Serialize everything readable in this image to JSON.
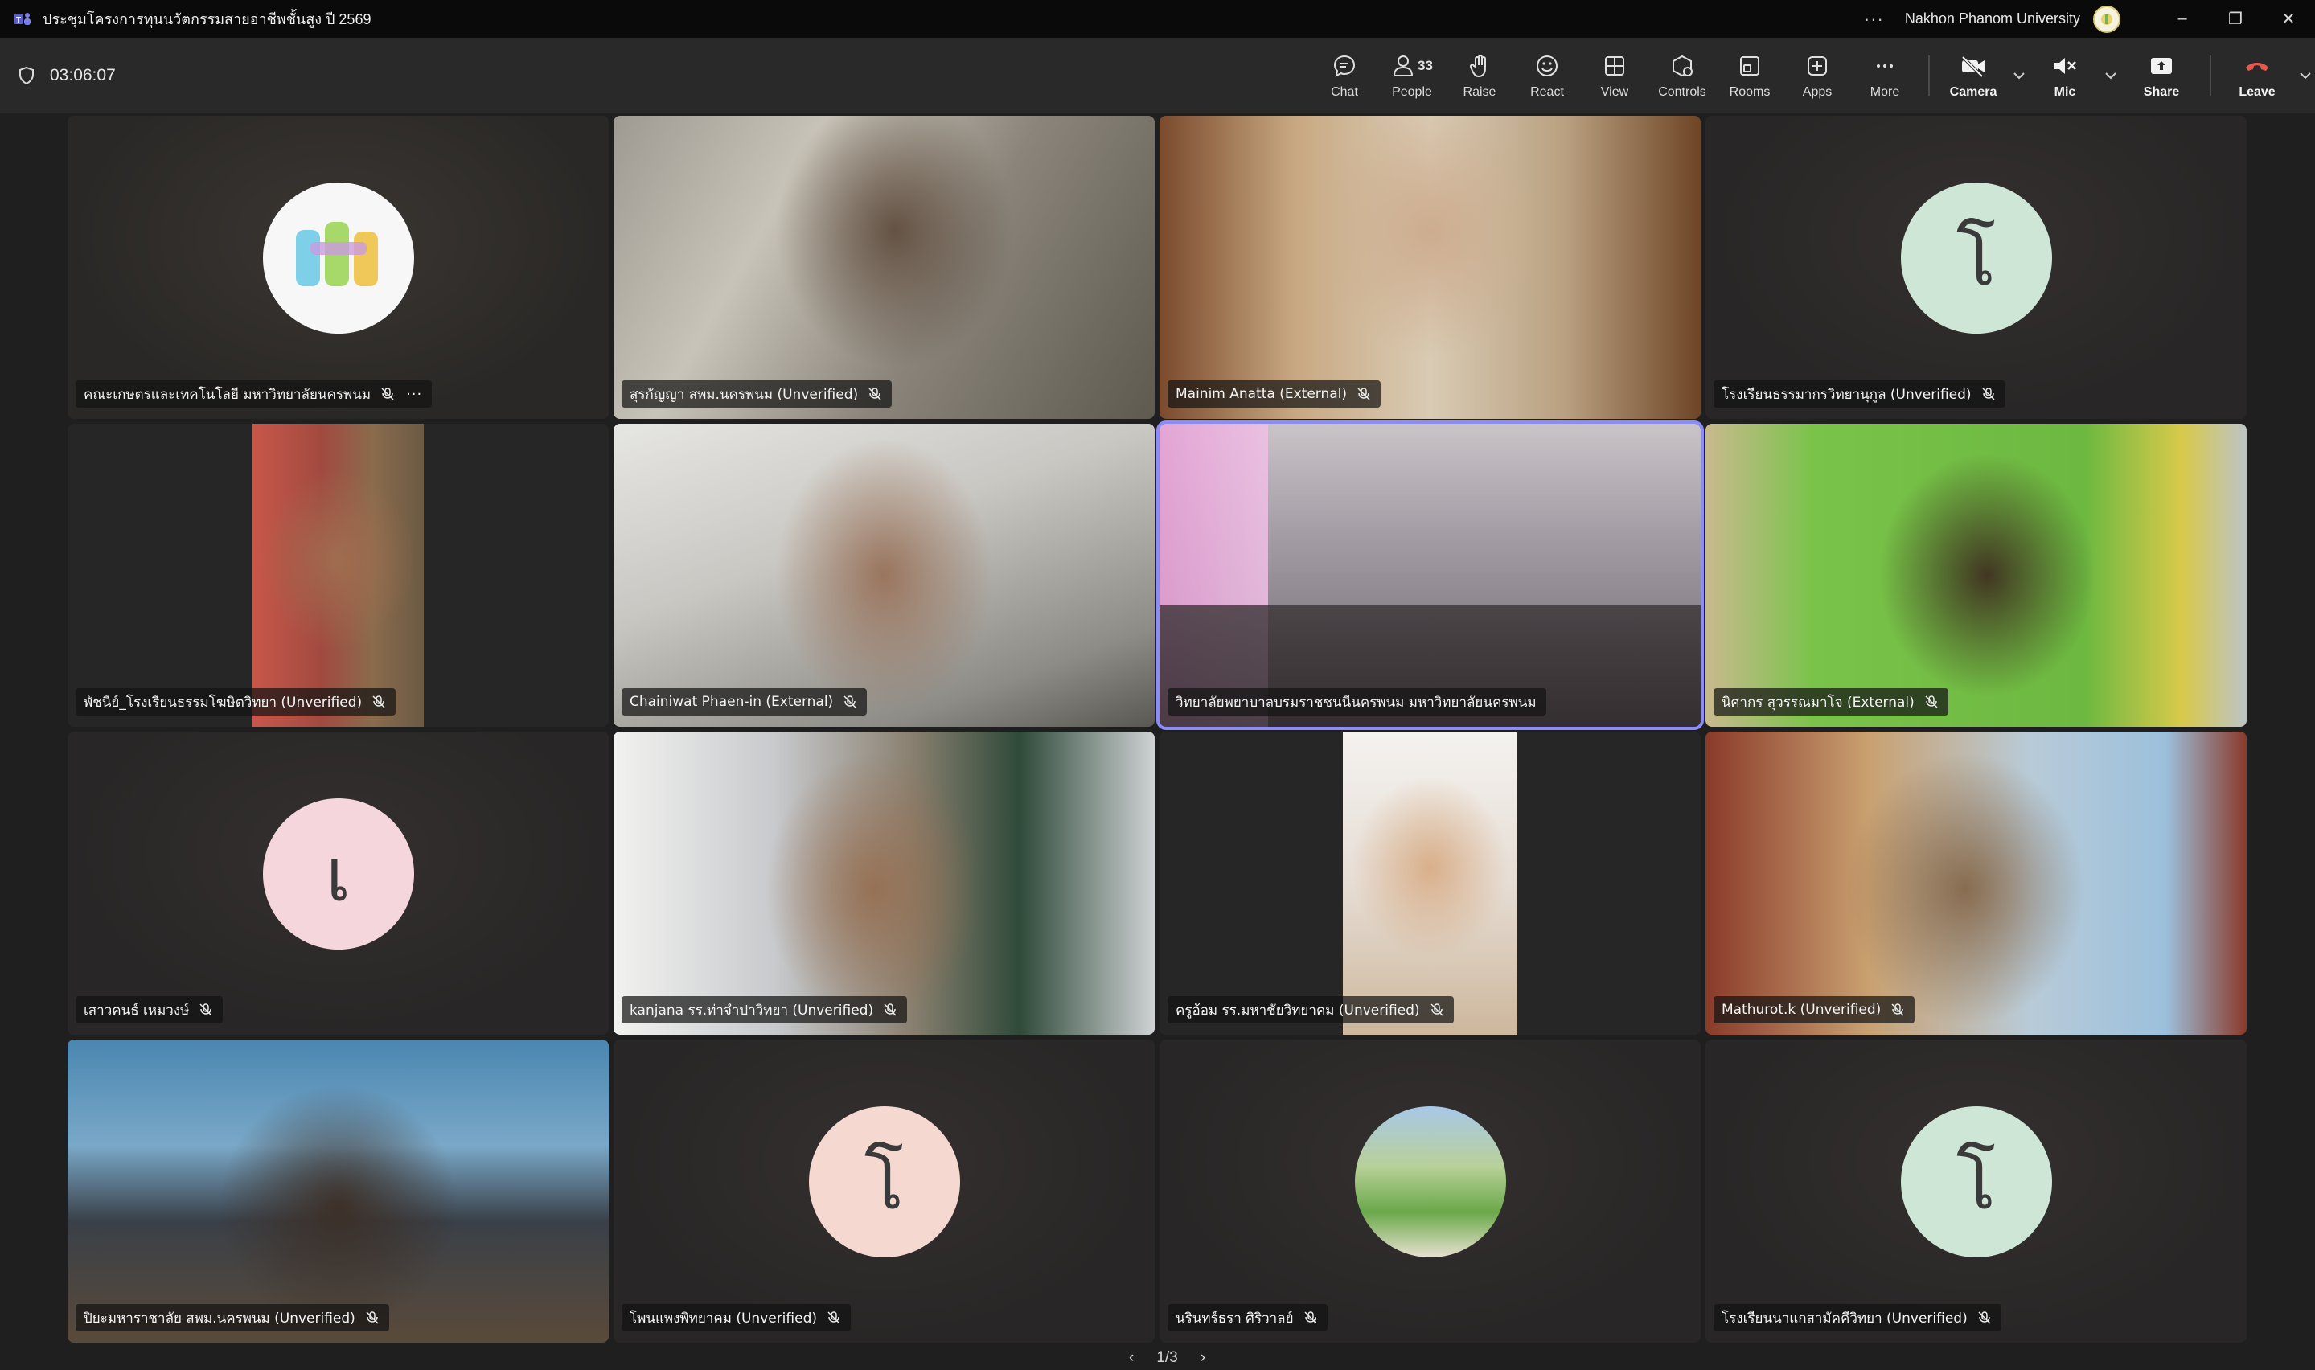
{
  "window": {
    "title": "ประชุมโครงการทุนนวัตกรรมสายอาชีพชั้นสูง ปี 2569",
    "more": "···",
    "org_name": "Nakhon Phanom University",
    "minimize": "–",
    "restore": "❐",
    "close": "✕"
  },
  "meeting": {
    "elapsed": "03:06:07",
    "people_count": "33"
  },
  "toolbar": [
    {
      "id": "chat",
      "label": "Chat"
    },
    {
      "id": "people",
      "label": "People"
    },
    {
      "id": "raise",
      "label": "Raise"
    },
    {
      "id": "react",
      "label": "React"
    },
    {
      "id": "view",
      "label": "View"
    },
    {
      "id": "controls",
      "label": "Controls"
    },
    {
      "id": "rooms",
      "label": "Rooms"
    },
    {
      "id": "apps",
      "label": "Apps"
    },
    {
      "id": "more",
      "label": "More"
    },
    {
      "id": "camera",
      "label": "Camera"
    },
    {
      "id": "mic",
      "label": "Mic"
    },
    {
      "id": "share",
      "label": "Share"
    },
    {
      "id": "leave",
      "label": "Leave"
    }
  ],
  "colors": {
    "accent": "#8b8cf7",
    "leave": "#e8584f",
    "toolbar_bg": "#292929",
    "titlebar_bg": "#0a0a0a"
  },
  "participants": [
    {
      "name": "คณะเกษตรและเทคโนโลยี มหาวิทยาลัยนครพนม",
      "avatar": "logo",
      "muted": true,
      "more": "···"
    },
    {
      "name": "สุรกัญญา สพม.นครพนม (Unverified)",
      "avatar": "video",
      "muted": true
    },
    {
      "name": "Mainim Anatta (External)",
      "avatar": "video",
      "muted": true
    },
    {
      "name": "โรงเรียนธรรมากรวิทยานุกูล (Unverified)",
      "avatar": "โ",
      "avatar_color": "#cde6d5",
      "muted": true
    },
    {
      "name": "พัชนีย์_โรงเรียนธรรมโฆษิตวิทยา (Unverified)",
      "avatar": "video",
      "muted": true
    },
    {
      "name": "Chainiwat Phaen-in (External)",
      "avatar": "video",
      "muted": true
    },
    {
      "name": "วิทยาลัยพยาบาลบรมราชชนนีนครพนม มหาวิทยาลัยนครพนม",
      "avatar": "video",
      "muted": false,
      "active": true
    },
    {
      "name": "นิศากร สุวรรณมาโจ (External)",
      "avatar": "video",
      "muted": true
    },
    {
      "name": "เสาวคนธ์  เหมวงษ์",
      "avatar": "เ",
      "avatar_color": "#f4d6dc",
      "muted": true
    },
    {
      "name": "kanjana รร.ท่าจำปาวิทยา (Unverified)",
      "avatar": "video",
      "muted": true
    },
    {
      "name": "ครูอ้อม รร.มหาชัยวิทยาคม (Unverified)",
      "avatar": "video",
      "muted": true
    },
    {
      "name": "Mathurot.k (Unverified)",
      "avatar": "video",
      "muted": true
    },
    {
      "name": "ปิยะมหาราชาลัย สพม.นครพนม (Unverified)",
      "avatar": "video",
      "muted": true
    },
    {
      "name": "โพนแพงพิทยาคม (Unverified)",
      "avatar": "โ",
      "avatar_color": "#f5d9d1",
      "muted": true
    },
    {
      "name": "นรินทร์ธรา ศิริวาลย์",
      "avatar": "photo",
      "muted": true
    },
    {
      "name": "โรงเรียนนาแกสามัคคีวิทยา (Unverified)",
      "avatar": "โ",
      "avatar_color": "#cde6d5",
      "muted": true
    }
  ],
  "pager": {
    "prev": "‹",
    "label": "1/3",
    "next": "›"
  }
}
